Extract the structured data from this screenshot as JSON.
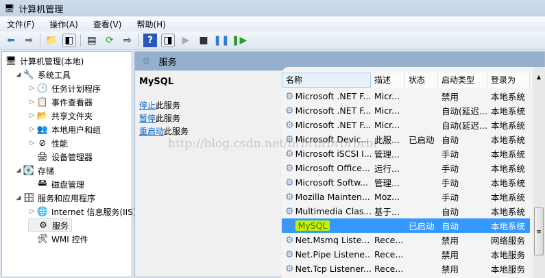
{
  "window": {
    "title": "计算机管理"
  },
  "menu": [
    "文件(F)",
    "操作(A)",
    "查看(V)",
    "帮助(H)"
  ],
  "tree": [
    {
      "label": "计算机管理(本地)",
      "icon": "computer-icon",
      "level": 0,
      "exp": ""
    },
    {
      "label": "系统工具",
      "icon": "tools-icon",
      "level": 1,
      "exp": "◢"
    },
    {
      "label": "任务计划程序",
      "icon": "clock-icon",
      "level": 2,
      "exp": "▷"
    },
    {
      "label": "事件查看器",
      "icon": "event-viewer-icon",
      "level": 2,
      "exp": "▷"
    },
    {
      "label": "共享文件夹",
      "icon": "shared-folder-icon",
      "level": 2,
      "exp": "▷"
    },
    {
      "label": "本地用户和组",
      "icon": "users-icon",
      "level": 2,
      "exp": "▷"
    },
    {
      "label": "性能",
      "icon": "performance-icon",
      "level": 2,
      "exp": "▷"
    },
    {
      "label": "设备管理器",
      "icon": "device-manager-icon",
      "level": 2,
      "exp": ""
    },
    {
      "label": "存储",
      "icon": "storage-icon",
      "level": 1,
      "exp": "◢"
    },
    {
      "label": "磁盘管理",
      "icon": "disk-icon",
      "level": 2,
      "exp": ""
    },
    {
      "label": "服务和应用程序",
      "icon": "services-apps-icon",
      "level": 1,
      "exp": "◢"
    },
    {
      "label": "Internet 信息服务(IIS)管",
      "icon": "iis-icon",
      "level": 2,
      "exp": "▷"
    },
    {
      "label": "服务",
      "icon": "gear-icon",
      "level": 2,
      "exp": "",
      "selected": true
    },
    {
      "label": "WMI 控件",
      "icon": "wmi-icon",
      "level": 2,
      "exp": ""
    }
  ],
  "panel": {
    "title": "服务",
    "service_name": "MySQL",
    "actions": [
      {
        "link": "停止",
        "rest": "此服务"
      },
      {
        "link": "暂停",
        "rest": "此服务"
      },
      {
        "link": "重启动",
        "rest": "此服务"
      }
    ]
  },
  "watermark": "http://blog.csdn.net/brbrbrbrbrbrbr",
  "columns": [
    "名称",
    "描述",
    "状态",
    "启动类型",
    "登录为"
  ],
  "rows": [
    [
      "Microsoft .NET F...",
      "Micr...",
      "",
      "禁用",
      "本地系统"
    ],
    [
      "Microsoft .NET F...",
      "Micr...",
      "",
      "自动(延迟...",
      "本地系统"
    ],
    [
      "Microsoft .NET F...",
      "Micr...",
      "",
      "自动(延迟...",
      "本地系统"
    ],
    [
      "Microsoft Devic...",
      "此服...",
      "已启动",
      "自动",
      "本地系统"
    ],
    [
      "Microsoft iSCSI I...",
      "管理...",
      "",
      "手动",
      "本地系统"
    ],
    [
      "Microsoft Office...",
      "运行...",
      "",
      "手动",
      "本地系统"
    ],
    [
      "Microsoft Softw...",
      "管理...",
      "",
      "手动",
      "本地系统"
    ],
    [
      "Mozilla Mainten...",
      "Moz...",
      "",
      "手动",
      "本地系统"
    ],
    [
      "Multimedia Clas...",
      "基于...",
      "",
      "自动",
      "本地系统"
    ],
    [
      "MySQL",
      "",
      "已启动",
      "自动",
      "本地系统"
    ],
    [
      "Net.Msmq Liste...",
      "Rece...",
      "",
      "禁用",
      "网络服务"
    ],
    [
      "Net.Pipe Listene...",
      "Rece...",
      "",
      "禁用",
      "本地服务"
    ],
    [
      "Net.Tcp Listener...",
      "Rece...",
      "",
      "禁用",
      "本地服务"
    ]
  ],
  "selected_row": 9
}
